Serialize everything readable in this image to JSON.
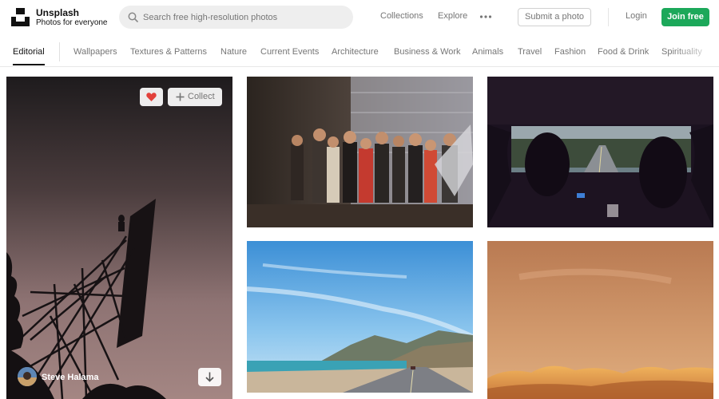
{
  "brand": {
    "name": "Unsplash",
    "tagline": "Photos for everyone"
  },
  "search": {
    "placeholder": "Search free high-resolution photos",
    "value": ""
  },
  "header_nav": {
    "collections": "Collections",
    "explore": "Explore",
    "more_icon": "ellipsis-icon",
    "submit": "Submit a photo",
    "login": "Login",
    "join": "Join free"
  },
  "tabs": [
    "Editorial",
    "Wallpapers",
    "Textures & Patterns",
    "Nature",
    "Current Events",
    "Architecture",
    "Business & Work",
    "Animals",
    "Travel",
    "Fashion",
    "Food & Drink",
    "Spirituality"
  ],
  "active_tab": "Editorial",
  "featured_photo": {
    "author": "Steve Halama",
    "collect_label": "Collect",
    "liked": true,
    "like_icon": "heart-icon",
    "download_icon": "download-arrow-icon"
  },
  "colors": {
    "accent_green": "#1ca85a",
    "heart_red": "#e2413b",
    "muted_text": "#767676"
  }
}
